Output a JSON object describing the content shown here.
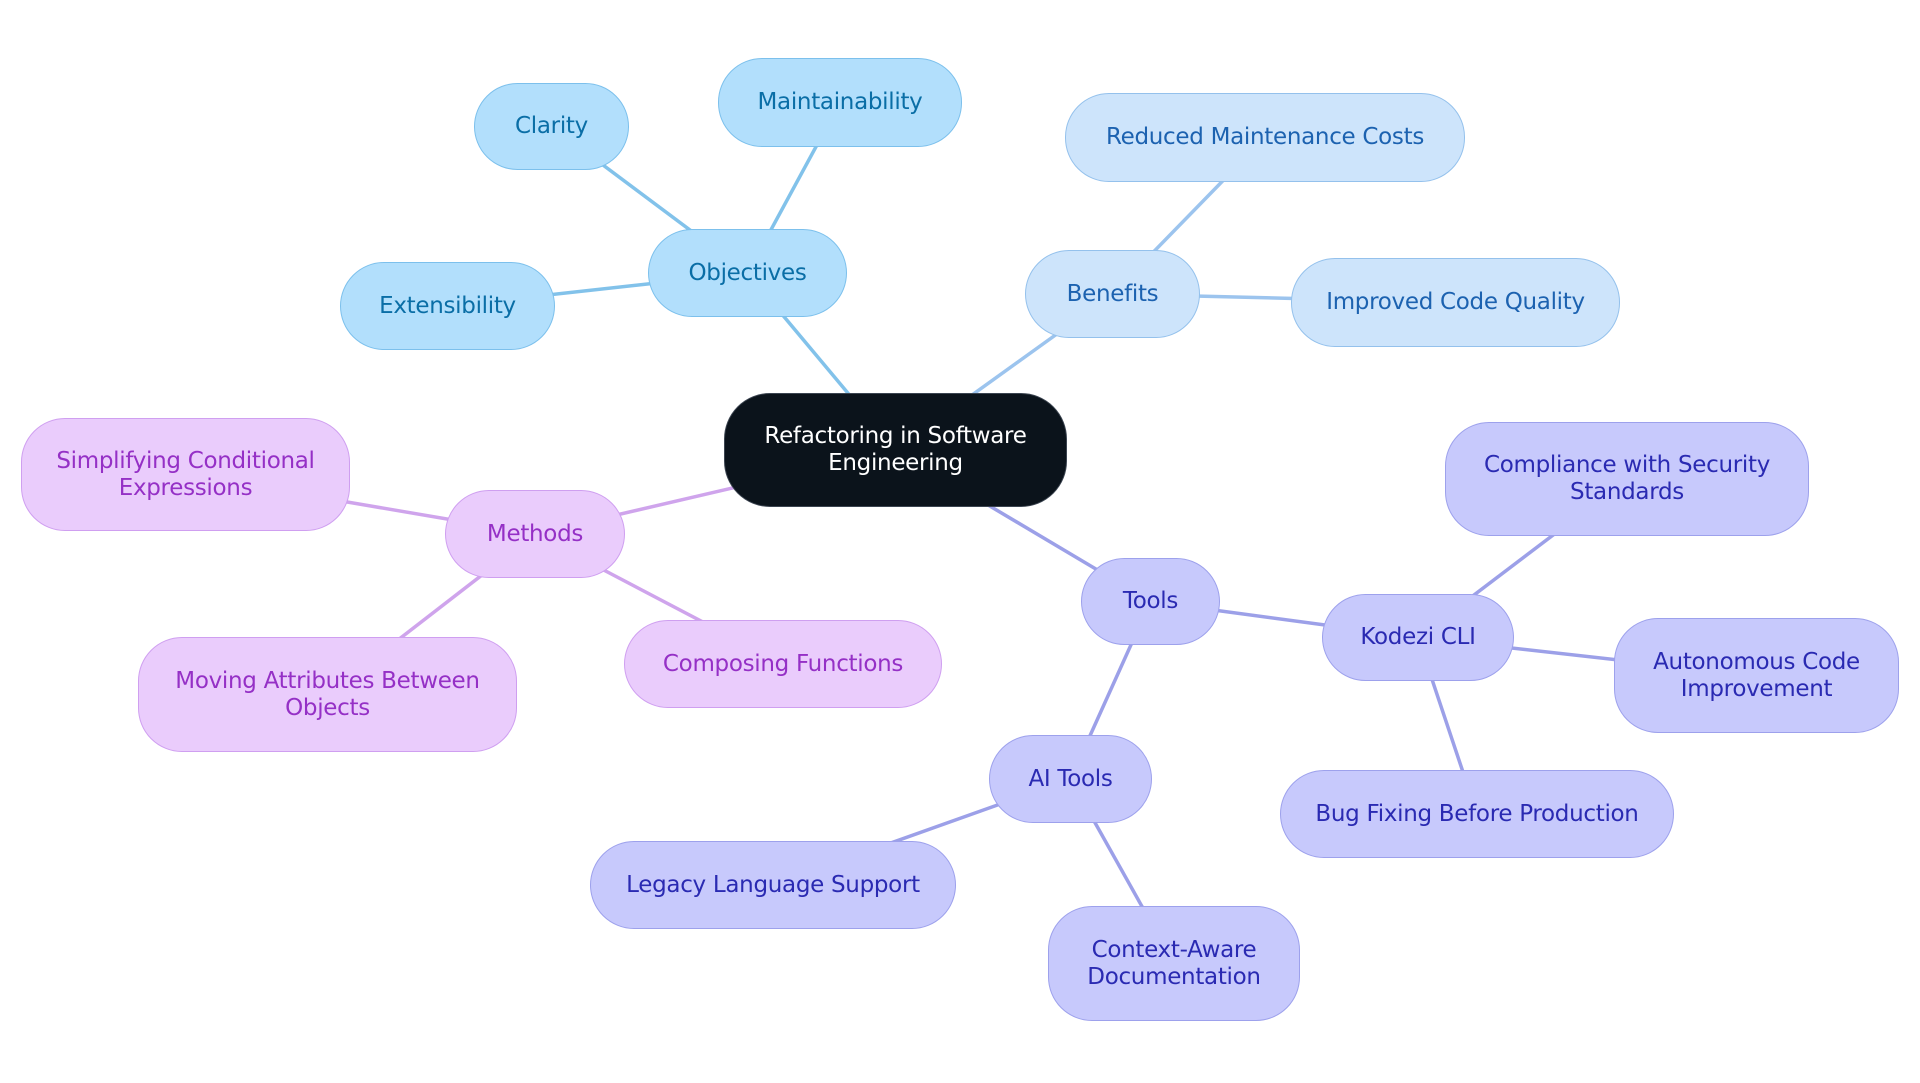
{
  "diagram": {
    "type": "mindmap",
    "root": {
      "id": "root",
      "label": "Refactoring in Software Engineering",
      "lines": [
        "Refactoring in Software",
        "Engineering"
      ]
    },
    "nodes": [
      {
        "id": "objectives",
        "parent": "root",
        "branch": "objectives",
        "lines": [
          "Objectives"
        ]
      },
      {
        "id": "clarity",
        "parent": "objectives",
        "branch": "objectives",
        "lines": [
          "Clarity"
        ]
      },
      {
        "id": "maintainability",
        "parent": "objectives",
        "branch": "objectives",
        "lines": [
          "Maintainability"
        ]
      },
      {
        "id": "extensibility",
        "parent": "objectives",
        "branch": "objectives",
        "lines": [
          "Extensibility"
        ]
      },
      {
        "id": "benefits",
        "parent": "root",
        "branch": "benefits",
        "lines": [
          "Benefits"
        ]
      },
      {
        "id": "reduced-maintenance-costs",
        "parent": "benefits",
        "branch": "benefits",
        "lines": [
          "Reduced Maintenance Costs"
        ]
      },
      {
        "id": "improved-code-quality",
        "parent": "benefits",
        "branch": "benefits",
        "lines": [
          "Improved Code Quality"
        ]
      },
      {
        "id": "methods",
        "parent": "root",
        "branch": "methods",
        "lines": [
          "Methods"
        ]
      },
      {
        "id": "simplifying-conditional-expressions",
        "parent": "methods",
        "branch": "methods",
        "lines": [
          "Simplifying Conditional",
          "Expressions"
        ]
      },
      {
        "id": "moving-attributes-between-objects",
        "parent": "methods",
        "branch": "methods",
        "lines": [
          "Moving Attributes Between",
          "Objects"
        ]
      },
      {
        "id": "composing-functions",
        "parent": "methods",
        "branch": "methods",
        "lines": [
          "Composing Functions"
        ]
      },
      {
        "id": "tools",
        "parent": "root",
        "branch": "tools",
        "lines": [
          "Tools"
        ]
      },
      {
        "id": "kodezi-cli",
        "parent": "tools",
        "branch": "tools",
        "lines": [
          "Kodezi CLI"
        ]
      },
      {
        "id": "compliance-with-security-standards",
        "parent": "kodezi-cli",
        "branch": "tools",
        "lines": [
          "Compliance with Security",
          "Standards"
        ]
      },
      {
        "id": "autonomous-code-improvement",
        "parent": "kodezi-cli",
        "branch": "tools",
        "lines": [
          "Autonomous Code",
          "Improvement"
        ]
      },
      {
        "id": "bug-fixing-before-production",
        "parent": "kodezi-cli",
        "branch": "tools",
        "lines": [
          "Bug Fixing Before Production"
        ]
      },
      {
        "id": "ai-tools",
        "parent": "tools",
        "branch": "tools",
        "lines": [
          "AI Tools"
        ]
      },
      {
        "id": "legacy-language-support",
        "parent": "ai-tools",
        "branch": "tools",
        "lines": [
          "Legacy Language Support"
        ]
      },
      {
        "id": "context-aware-documentation",
        "parent": "ai-tools",
        "branch": "tools",
        "lines": [
          "Context-Aware",
          "Documentation"
        ]
      }
    ],
    "branch_colors": {
      "root": {
        "fill": "#0b131b",
        "text": "#ffffff"
      },
      "objectives": {
        "fill": "#b2dffc",
        "stroke": "#7cc0ec",
        "text": "#0a6ea6",
        "edge": "#82c2ea"
      },
      "benefits": {
        "fill": "#cde4fb",
        "stroke": "#94c1ec",
        "text": "#1c62b0",
        "edge": "#9cc4ee"
      },
      "methods": {
        "fill": "#eaccfc",
        "stroke": "#cf9ff0",
        "text": "#9530c6",
        "edge": "#cfa4ec"
      },
      "tools": {
        "fill": "#c7c9fc",
        "stroke": "#9da1ec",
        "text": "#2a2ab2",
        "edge": "#9ca0e8"
      }
    }
  }
}
